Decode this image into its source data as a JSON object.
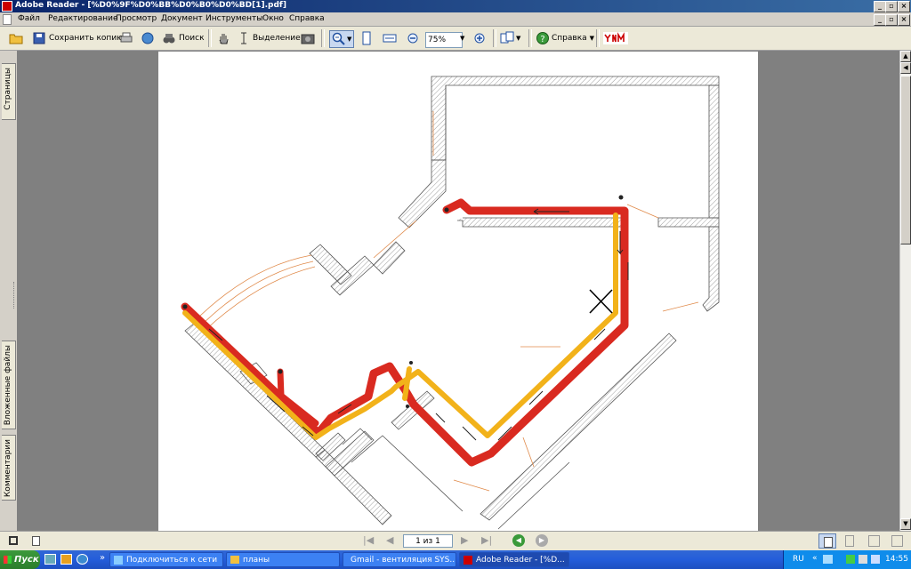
{
  "window": {
    "title": "Adobe Reader - [%D0%9F%D0%BB%D0%B0%D0%BD[1].pdf]"
  },
  "menu": [
    "Файл",
    "Редактирование",
    "Просмотр",
    "Документ",
    "Инструменты",
    "Окно",
    "Справка"
  ],
  "toolbar": {
    "save_copy": "Сохранить копию",
    "search": "Поиск",
    "select": "Выделение",
    "zoom_value": "75%",
    "help": "Справка"
  },
  "side_tabs": [
    "Страницы",
    "Вложенные файлы",
    "Комментарии"
  ],
  "status": {
    "page_indicator": "1 из 1"
  },
  "taskbar": {
    "start": "Пуск",
    "tasks": [
      "Подключиться к сети",
      "планы",
      "Gmail - вентиляция SYS...",
      "Adobe Reader - [%D..."
    ],
    "lang": "RU",
    "clock": "14:55"
  },
  "colors": {
    "duct_red": "#d92a20",
    "duct_yellow": "#f2b21a",
    "title_bar": "#0a246a"
  }
}
